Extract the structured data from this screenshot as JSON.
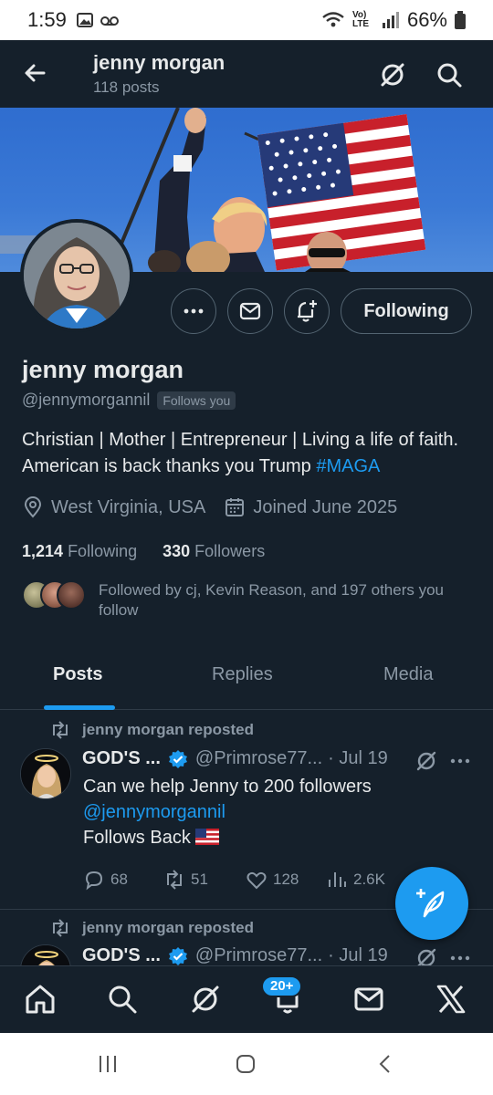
{
  "status_bar": {
    "time": "1:59",
    "signal_label": "Vo) LTE",
    "battery": "66%",
    "icons": [
      "gallery-icon",
      "voicemail-icon",
      "wifi-icon",
      "signal-icon",
      "battery-icon"
    ]
  },
  "header": {
    "name": "jenny morgan",
    "posts_count": "118 posts",
    "icons": [
      "back-arrow-icon",
      "grok-icon",
      "search-icon"
    ]
  },
  "profile": {
    "name": "jenny morgan",
    "handle": "@jennymorgannil",
    "follows_you": "Follows you",
    "bio_text": "Christian | Mother | Entrepreneur | Living a life of faith. American is back thanks you Trump ",
    "bio_hashtag": "#MAGA",
    "location": "West Virginia, USA",
    "joined": "Joined June 2025",
    "following_count": "1,214",
    "following_label": "Following",
    "followers_count": "330",
    "followers_label": "Followers",
    "followed_by": "Followed by cj, Kevin Reason, and 197 others you follow",
    "following_button": "Following"
  },
  "tabs": [
    {
      "label": "Posts",
      "active": true
    },
    {
      "label": "Replies",
      "active": false
    },
    {
      "label": "Media",
      "active": false
    }
  ],
  "posts": [
    {
      "repost_label": "jenny morgan reposted",
      "name": "GOD'S ...",
      "handle": "@Primrose77...",
      "date": "· Jul 19",
      "text_line1": "Can we help Jenny to 200 followers",
      "mention": "@jennymorgannil",
      "text_line3": "Follows Back",
      "replies": "68",
      "reposts": "51",
      "likes": "128",
      "views": "2.6K"
    },
    {
      "repost_label": "jenny morgan reposted",
      "name": "GOD'S ...",
      "handle": "@Primrose77...",
      "date": "· Jul 19"
    }
  ],
  "bottom_nav": {
    "notifications_badge": "20+",
    "items": [
      "home-icon",
      "search-icon",
      "grok-icon",
      "notifications-icon",
      "messages-icon",
      "x-logo-icon"
    ]
  },
  "colors": {
    "background": "#15202b",
    "accent": "#1d9bf0",
    "secondary_text": "#8b98a5",
    "primary_text": "#e7e9ea",
    "border": "#2f3b47"
  }
}
